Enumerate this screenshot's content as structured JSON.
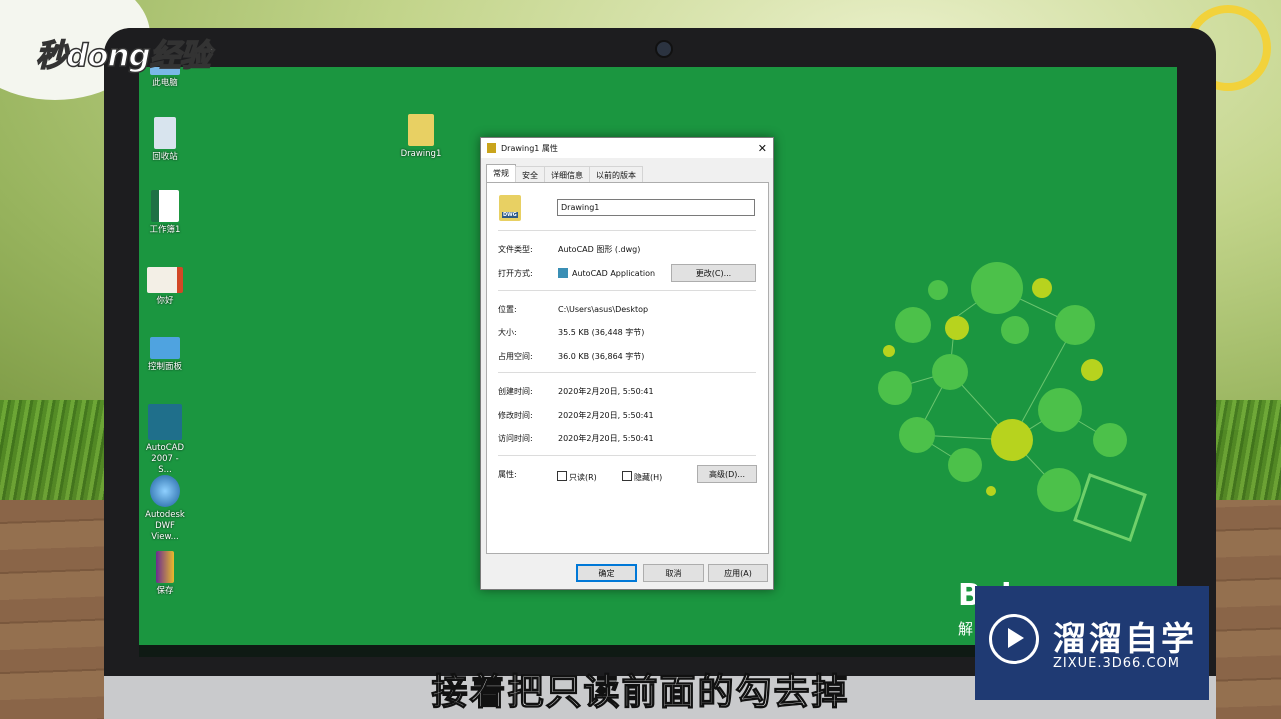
{
  "watermark": {
    "logo_text": "秒dong经验"
  },
  "desktop": {
    "icons": [
      {
        "label": "此电脑"
      },
      {
        "label": "回收站"
      },
      {
        "label": "工作簿1"
      },
      {
        "label": "你好"
      },
      {
        "label": "控制面板"
      },
      {
        "label": "AutoCAD 2007 - S..."
      },
      {
        "label": "Autodesk DWF View..."
      },
      {
        "label": "保存"
      },
      {
        "label": "Drawing1"
      }
    ]
  },
  "dialog": {
    "title": "Drawing1 属性",
    "tabs": [
      "常规",
      "安全",
      "详细信息",
      "以前的版本"
    ],
    "active_tab": "常规",
    "filename": "Drawing1",
    "file_icon_text": "DWG",
    "file_type_label": "文件类型:",
    "file_type_value": "AutoCAD 图形 (.dwg)",
    "open_with_label": "打开方式:",
    "open_with_value": "AutoCAD Application",
    "change_button": "更改(C)...",
    "location_label": "位置:",
    "location_value": "C:\\Users\\asus\\Desktop",
    "size_label": "大小:",
    "size_value": "35.5 KB (36,448 字节)",
    "disk_label": "占用空间:",
    "disk_value": "36.0 KB (36,864 字节)",
    "created_label": "创建时间:",
    "created_value": "2020年2月20日, 5:50:41",
    "modified_label": "修改时间:",
    "modified_value": "2020年2月20日, 5:50:41",
    "accessed_label": "访问时间:",
    "accessed_value": "2020年2月20日, 5:50:41",
    "attributes_label": "属性:",
    "readonly_label": "只读(R)",
    "hidden_label": "隐藏(H)",
    "advanced_button": "高级(D)...",
    "ok_button": "确定",
    "cancel_button": "取消",
    "apply_button": "应用(A)"
  },
  "subtitle": "接着把只读前面的勾去掉",
  "badge": {
    "title": "溜溜自学",
    "url": "ZIXUE.3D66.COM"
  },
  "baidu": {
    "logo": "Bai",
    "tagline": "解"
  },
  "colors": {
    "desktop": "#1b9640",
    "badge": "#1f3a73"
  }
}
